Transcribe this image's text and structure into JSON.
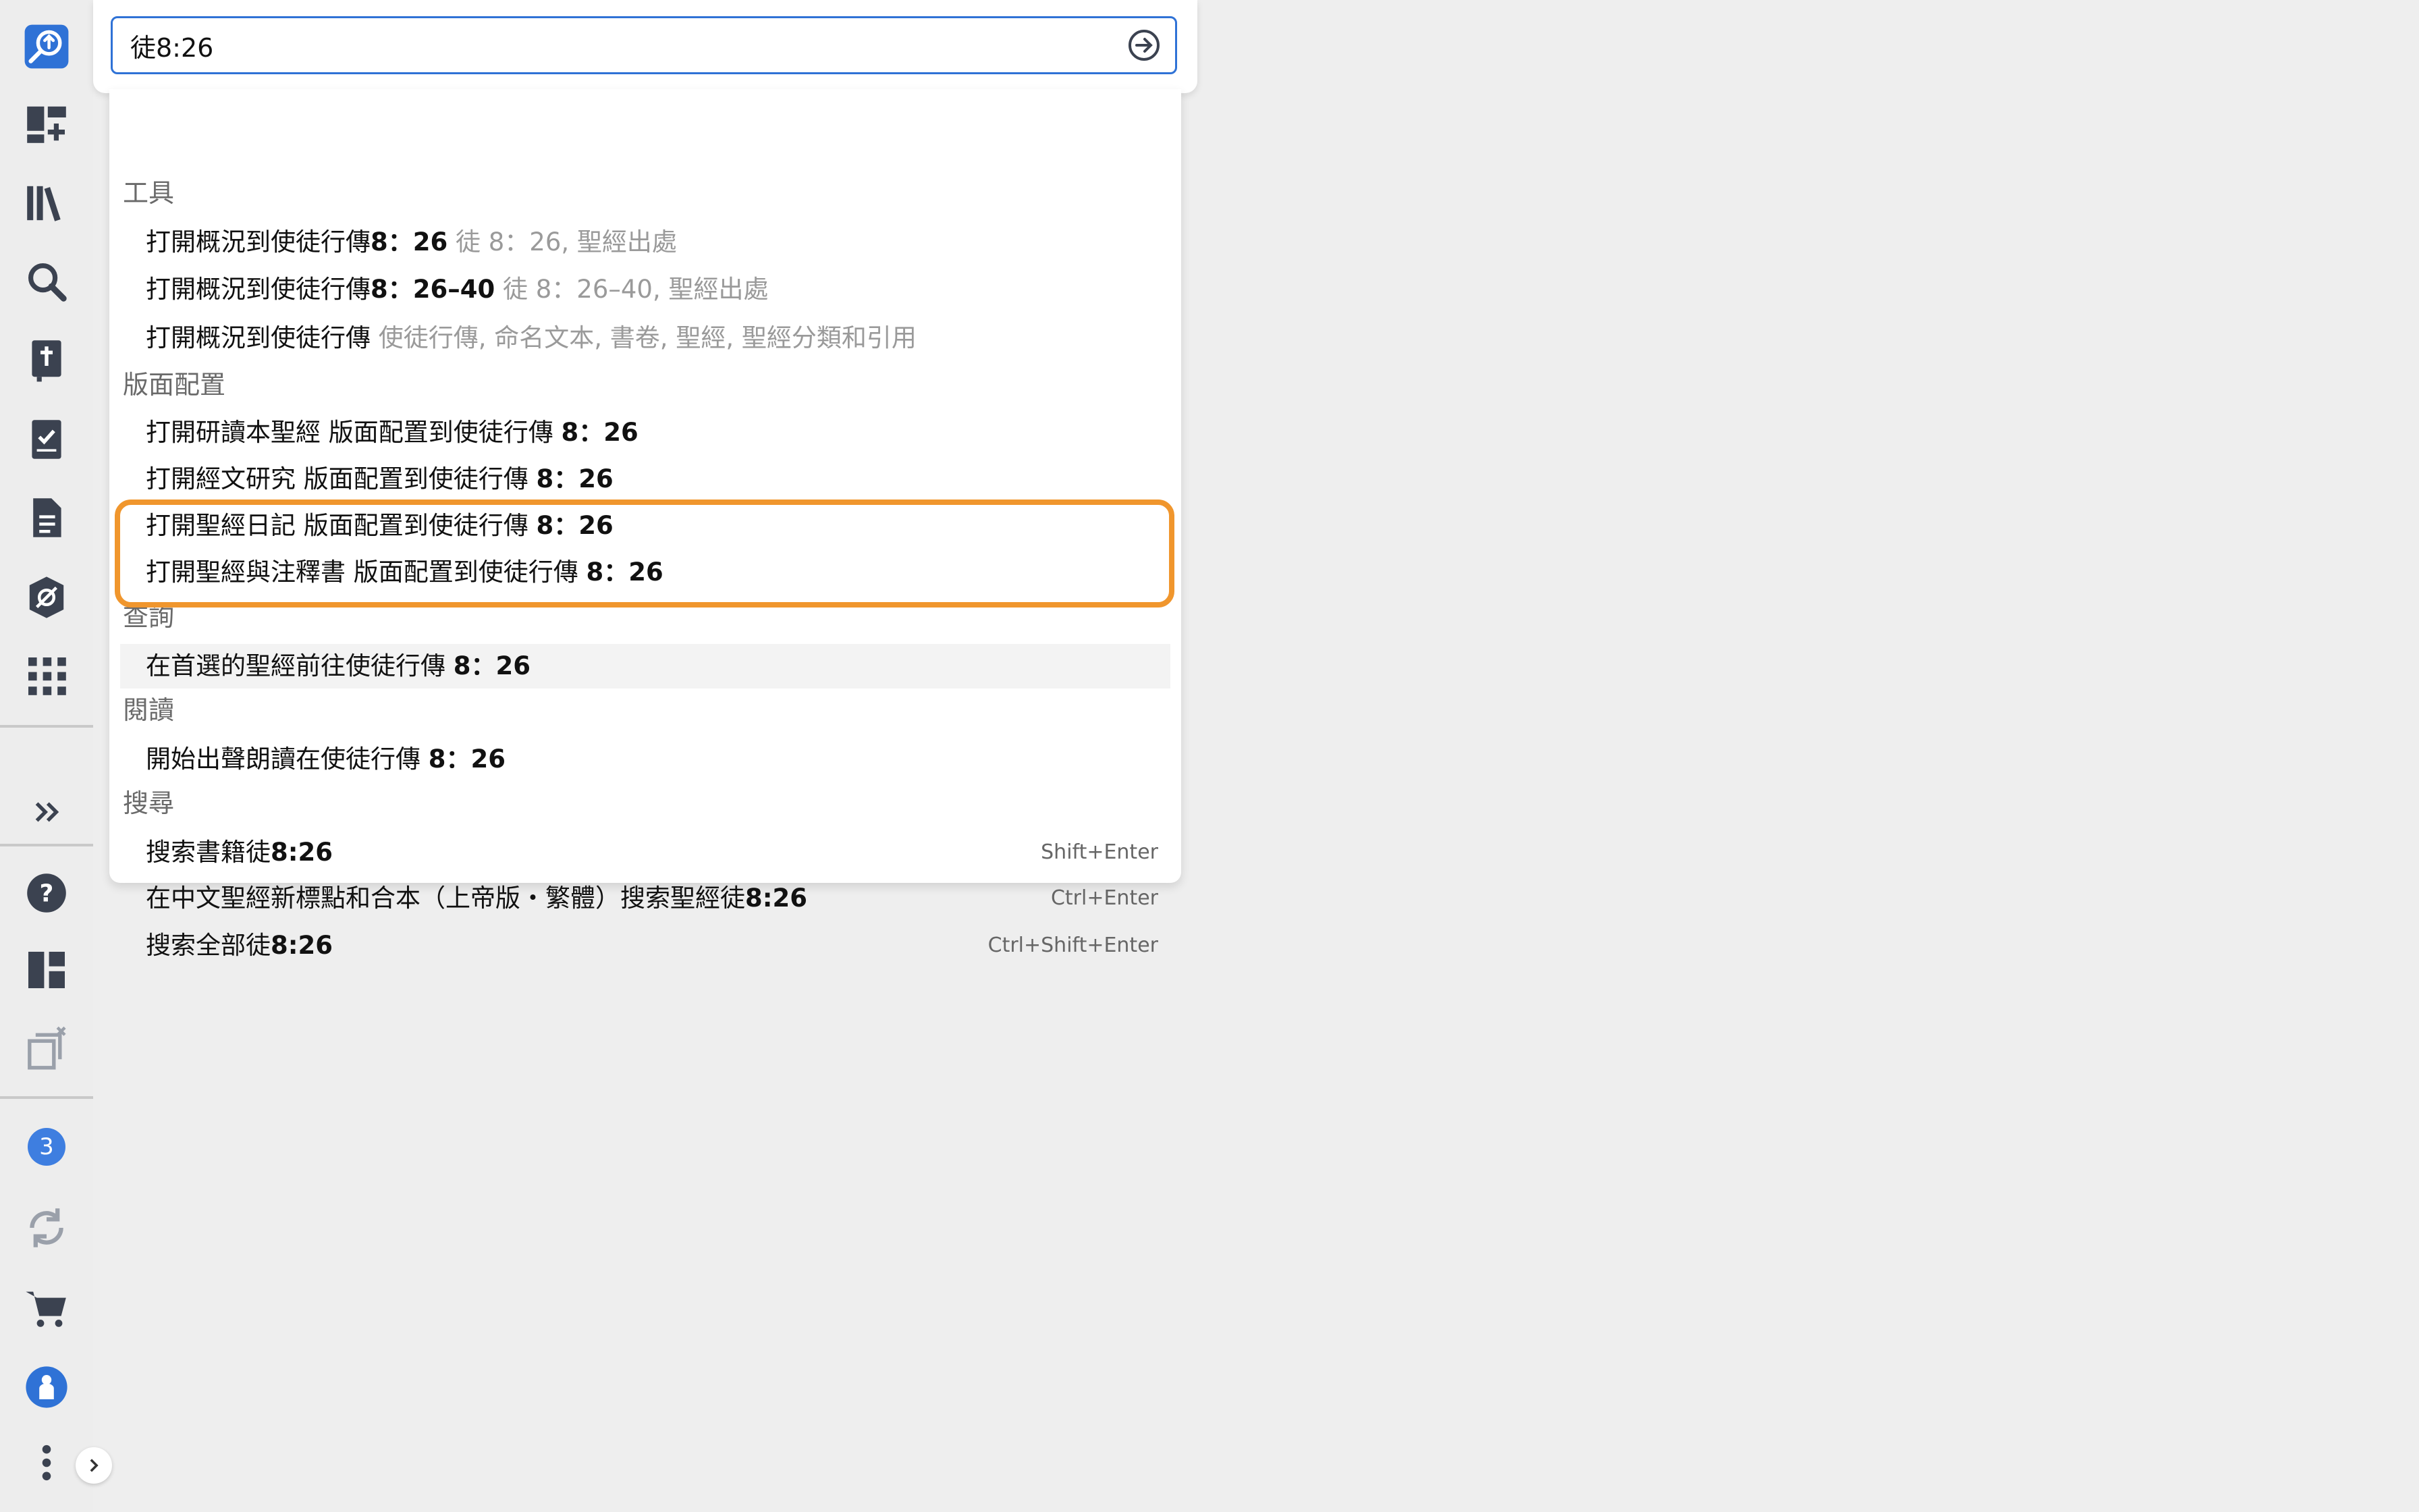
{
  "search": {
    "query": "徒8:26"
  },
  "sidebar": {
    "badge_count": "3"
  },
  "groups": {
    "tools": {
      "header": "工具",
      "items": [
        {
          "label": "打開概況到使徒行傳",
          "ref": "8：26",
          "hint": "徒 8：26, 聖經出處"
        },
        {
          "label": "打開概況到使徒行傳",
          "ref": "8：26–40",
          "hint": "徒 8：26–40, 聖經出處"
        },
        {
          "label": "打開概況到使徒行傳",
          "ref": "",
          "hint": "使徒行傳, 命名文本, 書卷, 聖經, 聖經分類和引用"
        }
      ]
    },
    "layouts": {
      "header": "版面配置",
      "items": [
        {
          "label": "打開研讀本聖經 版面配置到使徒行傳",
          "ref": "8：26"
        },
        {
          "label": "打開經文研究 版面配置到使徒行傳",
          "ref": "8：26"
        },
        {
          "label": "打開聖經日記 版面配置到使徒行傳",
          "ref": "8：26"
        },
        {
          "label": "打開聖經與注釋書 版面配置到使徒行傳",
          "ref": "8：26"
        }
      ]
    },
    "lookup": {
      "header": "查詢",
      "items": [
        {
          "label": "在首選的聖經前往使徒行傳",
          "ref": "8：26"
        }
      ]
    },
    "reading": {
      "header": "閱讀",
      "items": [
        {
          "label": "開始出聲朗讀在使徒行傳",
          "ref": "8：26"
        }
      ]
    },
    "search": {
      "header": "搜尋",
      "items": [
        {
          "label": "搜索書籍徒",
          "ref": "8:26",
          "shortcut": "Shift+Enter"
        },
        {
          "label": "在中文聖經新標點和合本（上帝版・繁體）搜索聖經徒",
          "ref": "8:26",
          "shortcut": "Ctrl+Enter"
        },
        {
          "label": "搜索全部徒",
          "ref": "8:26",
          "shortcut": "Ctrl+Shift+Enter"
        }
      ]
    }
  },
  "colors": {
    "accent": "#2f72d6",
    "highlight": "#f0962d",
    "icon": "#3b4250"
  }
}
